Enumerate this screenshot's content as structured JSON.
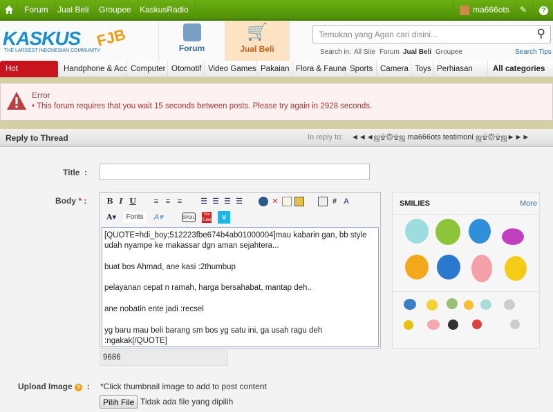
{
  "topbar": {
    "items": [
      "Forum",
      "Jual Beli",
      "Groupee",
      "KaskusRadio"
    ],
    "username": "ma666ots",
    "icons": [
      "home-icon",
      "avatar",
      "pencil-icon",
      "help-icon"
    ]
  },
  "header": {
    "logo_text": "KASKUS",
    "logo_tagline": "THE LARGEST INDONESIAN COMMUNITY",
    "logo_badge": "FJB",
    "tabs": [
      "Forum",
      "Jual Beli"
    ],
    "search_placeholder": "Temukan yang Agan cari disini...",
    "search_in_label": "Search in:",
    "search_in": [
      "All Site",
      "Forum",
      "Jual Beli",
      "Groupee"
    ],
    "search_tips": "Search Tips"
  },
  "categories": {
    "hot": "Hot categories",
    "items": [
      "Handphone & Acc",
      "Computer",
      "Otomotif",
      "Video Games",
      "Pakaian",
      "Flora & Fauna",
      "Sports",
      "Camera",
      "Toys",
      "Perhiasan"
    ],
    "all": "All categories"
  },
  "error": {
    "title": "Error",
    "message": "This forum requires that you wait 15 seconds between posts. Please try again in 2928 seconds."
  },
  "reply": {
    "heading": "Reply to Thread",
    "in_reply_label": "In reply to:",
    "thread_title": "◄◄◄ஜ۩۞۩ஜ ma666ots testimoni ஜ۩۞۩ஜ►►►"
  },
  "form": {
    "title_label": "Title",
    "title_value": "",
    "body_label": "Body",
    "required": "*",
    "colon": ":",
    "fonts_label": "Fonts",
    "body_text": "[QUOTE=hdi_boy;512223fbe674b4ab01000004]mau kabarin gan, bb style udah nyampe ke makassar dgn aman sejahtera...\n\nbuat bos Ahmad, ane kasi :2thumbup\n\npelayanan cepat n ramah, harga bersahabat, mantap deh..\n\nane nobatin ente jadi :recsel\n\nyg baru mau beli barang sm bos yg satu ini, ga usah ragu deh :ngakak[/QUOTE]",
    "char_count": "9686",
    "upload_label": "Upload Image",
    "upload_hint": "*Click thumbnail image to add to post content",
    "file_button": "Pilih File",
    "file_status": "Tidak ada file yang dipilih"
  },
  "smilies": {
    "title": "SMILIES",
    "more": "More"
  },
  "colors": {
    "green": "#5a9a0a",
    "error": "#a33",
    "hot": "#c8141c",
    "link": "#3a6fb0"
  }
}
